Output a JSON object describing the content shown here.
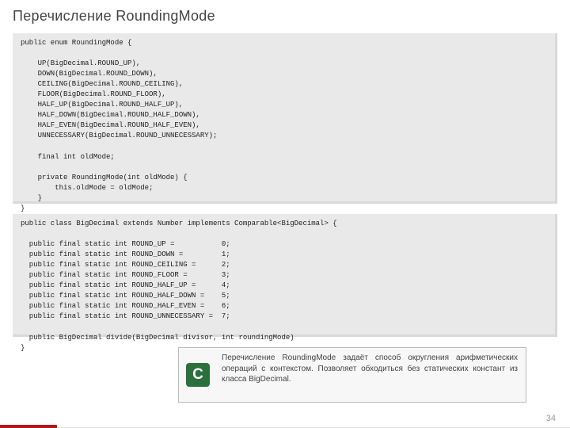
{
  "title": "Перечисление RoundingMode",
  "code1": "public enum RoundingMode {\n\n    UP(BigDecimal.ROUND_UP),\n    DOWN(BigDecimal.ROUND_DOWN),\n    CEILING(BigDecimal.ROUND_CEILING),\n    FLOOR(BigDecimal.ROUND_FLOOR),\n    HALF_UP(BigDecimal.ROUND_HALF_UP),\n    HALF_DOWN(BigDecimal.ROUND_HALF_DOWN),\n    HALF_EVEN(BigDecimal.ROUND_HALF_EVEN),\n    UNNECESSARY(BigDecimal.ROUND_UNNECESSARY);\n\n    final int oldMode;\n\n    private RoundingMode(int oldMode) {\n        this.oldMode = oldMode;\n    }\n}",
  "code2": "public class BigDecimal extends Number implements Comparable<BigDecimal> {\n\n  public final static int ROUND_UP =           0;\n  public final static int ROUND_DOWN =         1;\n  public final static int ROUND_CEILING =      2;\n  public final static int ROUND_FLOOR =        3;\n  public final static int ROUND_HALF_UP =      4;\n  public final static int ROUND_HALF_DOWN =    5;\n  public final static int ROUND_HALF_EVEN =    6;\n  public final static int ROUND_UNNECESSARY =  7;\n\n  public BigDecimal divide(BigDecimal divisor, int roundingMode)\n}",
  "note": {
    "icon_letter": "C",
    "text": "Перечисление RoundingMode задаёт способ округления арифметических операций с контекстом. Позволяет обходиться без статических констант из класса BigDecimal."
  },
  "page_number": "34"
}
